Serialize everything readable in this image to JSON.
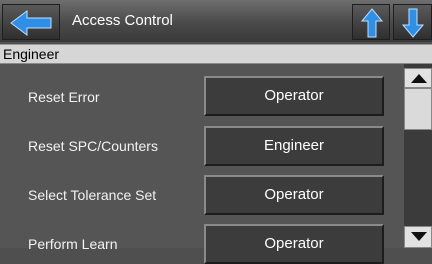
{
  "header": {
    "title": "Access Control",
    "back_icon": "arrow-left-icon",
    "up_icon": "arrow-up-icon",
    "down_icon": "arrow-down-icon",
    "accent_color": "#2f8fe6"
  },
  "role": {
    "label": "Engineer"
  },
  "permissions": [
    {
      "label": "Reset Error",
      "level": "Operator"
    },
    {
      "label": "Reset SPC/Counters",
      "level": "Engineer"
    },
    {
      "label": "Select Tolerance Set",
      "level": "Operator"
    },
    {
      "label": "Perform Learn",
      "level": "Operator"
    }
  ],
  "scrollbar": {
    "up_icon": "scroll-up-triangle-icon",
    "down_icon": "scroll-down-triangle-icon"
  }
}
